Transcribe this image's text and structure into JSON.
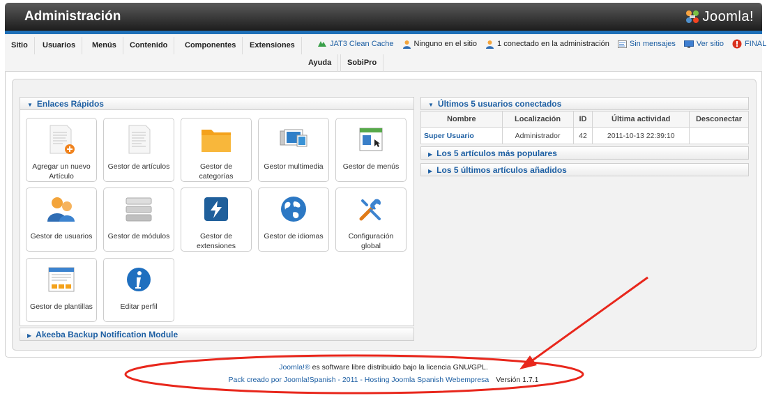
{
  "header": {
    "title": "Administración",
    "logo_text": "Joomla!"
  },
  "menu": {
    "row1": [
      "Sitio",
      "Usuarios",
      "Menús",
      "Contenido",
      "Componentes",
      "Extensiones"
    ],
    "row2": [
      "Ayuda",
      "SobiPro"
    ]
  },
  "status": {
    "cache": "JAT3 Clean Cache",
    "site": "Ninguno en el sitio",
    "admin": "1 conectado en la administración",
    "messages": "Sin mensajes",
    "view_site": "Ver sitio",
    "logout": "FINALIZAR"
  },
  "quick_links": {
    "title": "Enlaces Rápidos",
    "items": [
      {
        "label": "Agregar un nuevo Artículo",
        "icon": "add-article-icon"
      },
      {
        "label": "Gestor de artículos",
        "icon": "article-manager-icon"
      },
      {
        "label": "Gestor de categorías",
        "icon": "folder-icon"
      },
      {
        "label": "Gestor multimedia",
        "icon": "media-icon"
      },
      {
        "label": "Gestor de menús",
        "icon": "menu-icon"
      },
      {
        "label": "Gestor de usuarios",
        "icon": "users-icon"
      },
      {
        "label": "Gestor de módulos",
        "icon": "modules-icon"
      },
      {
        "label": "Gestor de extensiones",
        "icon": "extensions-icon"
      },
      {
        "label": "Gestor de idiomas",
        "icon": "globe-icon"
      },
      {
        "label": "Configuración global",
        "icon": "tools-icon"
      },
      {
        "label": "Gestor de plantillas",
        "icon": "templates-icon"
      },
      {
        "label": "Editar perfil",
        "icon": "info-icon"
      }
    ]
  },
  "akeeba": {
    "title": "Akeeba Backup Notification Module"
  },
  "last_users": {
    "title": "Últimos 5 usuarios conectados",
    "columns": [
      "Nombre",
      "Localización",
      "ID",
      "Última actividad",
      "Desconectar"
    ],
    "rows": [
      {
        "name": "Super Usuario",
        "location": "Administrador",
        "id": "42",
        "activity": "2011-10-13 22:39:10",
        "logout": ""
      }
    ]
  },
  "popular": {
    "title": "Los 5 artículos más populares"
  },
  "latest": {
    "title": "Los 5 últimos artículos añadidos"
  },
  "footer": {
    "joomla_link": "Joomla!®",
    "license_text": " es software libre distribuido bajo la licencia GNU/GPL.",
    "pack_link": "Pack creado por Joomla!Spanish - 2011 - Hosting Joomla Spanish Webempresa",
    "version": "Versión 1.7.1"
  },
  "colors": {
    "header_dark": "#1d1d1d",
    "accent_blue": "#1d5fa3",
    "annotation_red": "#e8271c"
  }
}
